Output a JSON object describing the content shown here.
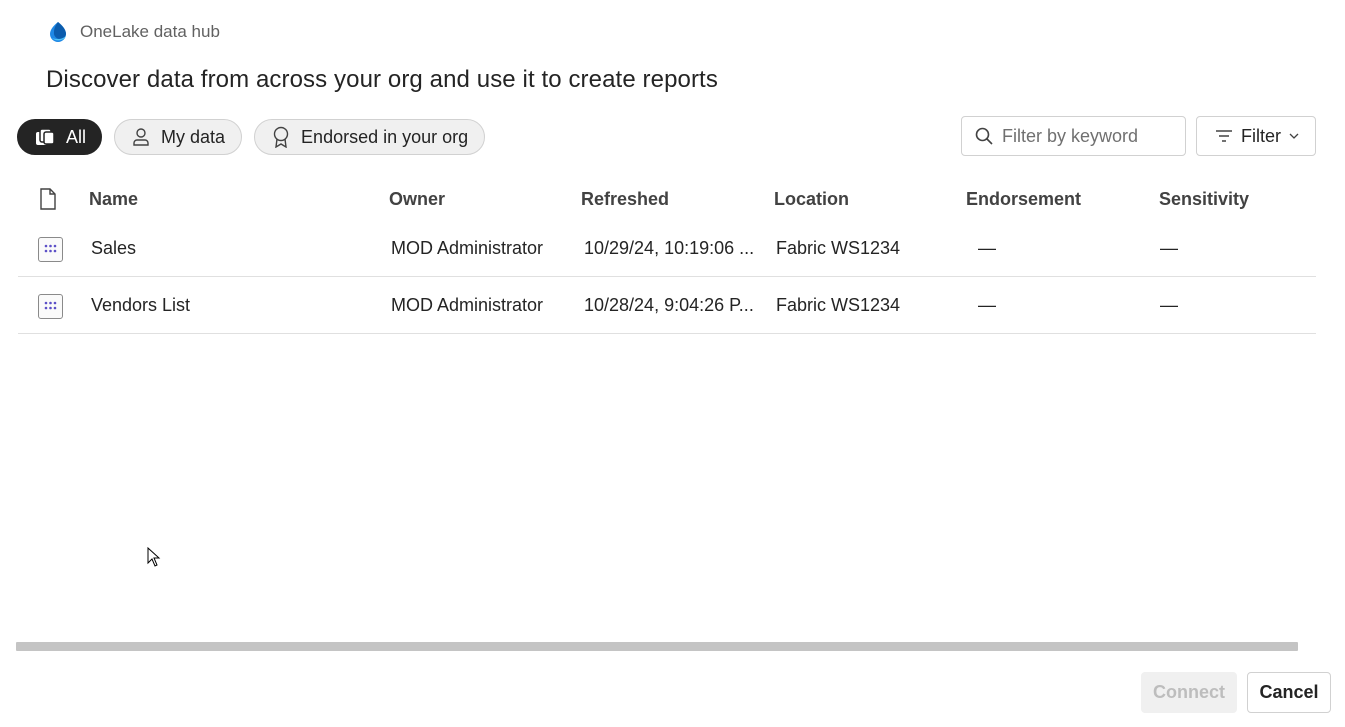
{
  "header": {
    "brand": "OneLake data hub"
  },
  "page_title": "Discover data from across your org and use it to create reports",
  "pills": [
    {
      "label": "All",
      "icon": "stack-icon",
      "active": true
    },
    {
      "label": "My data",
      "icon": "person-icon",
      "active": false
    },
    {
      "label": "Endorsed in your org",
      "icon": "ribbon-icon",
      "active": false
    }
  ],
  "search": {
    "placeholder": "Filter by keyword"
  },
  "filter": {
    "label": "Filter"
  },
  "table": {
    "columns": [
      "Name",
      "Owner",
      "Refreshed",
      "Location",
      "Endorsement",
      "Sensitivity"
    ],
    "rows": [
      {
        "name": "Sales",
        "owner": "MOD Administrator",
        "refreshed": "10/29/24, 10:19:06 ...",
        "location": "Fabric WS1234",
        "endorsement": "—",
        "sensitivity": "—"
      },
      {
        "name": "Vendors List",
        "owner": "MOD Administrator",
        "refreshed": "10/28/24, 9:04:26 P...",
        "location": "Fabric WS1234",
        "endorsement": "—",
        "sensitivity": "—"
      }
    ]
  },
  "footer": {
    "connect_label": "Connect",
    "cancel_label": "Cancel"
  },
  "colors": {
    "active_pill": "#242424",
    "icon_blue": "#0f6cbd",
    "icon_purple": "#5b4fc7"
  }
}
